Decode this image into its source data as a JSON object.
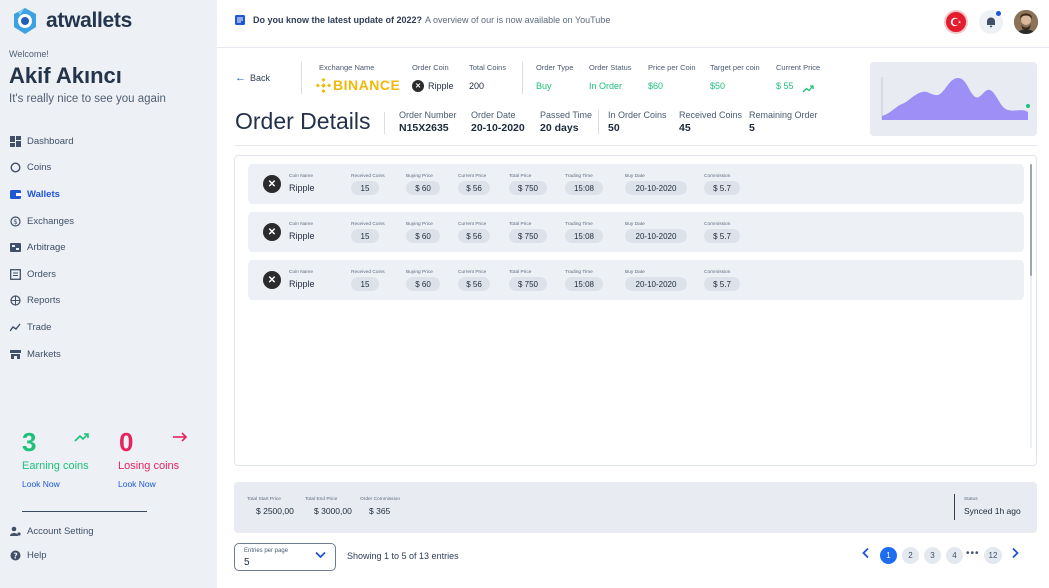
{
  "brand": {
    "name": "atwallets"
  },
  "user": {
    "welcome": "Welcome!",
    "name": "Akif Akıncı",
    "greeting": "It's really nice to see you again"
  },
  "nav": [
    {
      "label": "Dashboard",
      "icon": "dashboard-icon"
    },
    {
      "label": "Coins",
      "icon": "coins-icon"
    },
    {
      "label": "Wallets",
      "icon": "wallet-icon",
      "active": true
    },
    {
      "label": "Exchanges",
      "icon": "exchange-icon"
    },
    {
      "label": "Arbitrage",
      "icon": "arbitrage-icon"
    },
    {
      "label": "Orders",
      "icon": "orders-icon"
    },
    {
      "label": "Reports",
      "icon": "reports-icon"
    },
    {
      "label": "Trade",
      "icon": "trade-icon"
    },
    {
      "label": "Markets",
      "icon": "markets-icon"
    }
  ],
  "stats": {
    "earning": {
      "count": "3",
      "label": "Earning coins",
      "link": "Look Now",
      "color": "#1fc07a"
    },
    "losing": {
      "count": "0",
      "label": "Losing coins",
      "link": "Look Now",
      "color": "#e5245e"
    }
  },
  "sidebar_bottom": {
    "account": "Account Setting",
    "help": "Help"
  },
  "announcement": {
    "bold": "Do you know the latest update of 2022?",
    "text": "A overview of our is now available on YouTube"
  },
  "header": {
    "back": "Back",
    "exchange_name_label": "Exchange Name",
    "exchange_name": "BINANCE",
    "order_coin_label": "Order Coin",
    "order_coin": "Ripple",
    "total_coins_label": "Total Coins",
    "total_coins": "200",
    "order_type_label": "Order Type",
    "order_type": "Buy",
    "order_status_label": "Order Status",
    "order_status": "In Order",
    "price_per_coin_label": "Price per Coin",
    "price_per_coin": "$60",
    "target_per_coin_label": "Target per coin",
    "target_per_coin": "$50",
    "current_price_label": "Current Price",
    "current_price": "$ 55"
  },
  "title": "Order Details",
  "summary": {
    "order_number_label": "Order Number",
    "order_number": "N15X2635",
    "order_date_label": "Order Date",
    "order_date": "20-10-2020",
    "passed_time_label": "Passed Time",
    "passed_time": "20 days",
    "in_order_coins_label": "In Order Coins",
    "in_order_coins": "50",
    "received_coins_label": "Received Coins",
    "received_coins": "45",
    "remaining_order_label": "Remaining Order",
    "remaining_order": "5"
  },
  "columns": {
    "coin_name": "Coin Name",
    "received_coins": "Received Coins",
    "buying_price": "Buying Price",
    "current_price": "Current Price",
    "total_price": "Total Price",
    "trading_time": "Trading Time",
    "buy_date": "Buy Date",
    "commission": "Commission"
  },
  "orders": [
    {
      "coin_name": "Ripple",
      "received_coins": "15",
      "buying_price": "$ 60",
      "current_price": "$ 56",
      "total_price": "$ 750",
      "trading_time": "15:08",
      "buy_date": "20-10-2020",
      "commission": "$ 5.7"
    },
    {
      "coin_name": "Ripple",
      "received_coins": "15",
      "buying_price": "$ 60",
      "current_price": "$ 56",
      "total_price": "$ 750",
      "trading_time": "15:08",
      "buy_date": "20-10-2020",
      "commission": "$ 5.7"
    },
    {
      "coin_name": "Ripple",
      "received_coins": "15",
      "buying_price": "$ 60",
      "current_price": "$ 56",
      "total_price": "$ 750",
      "trading_time": "15:08",
      "buy_date": "20-10-2020",
      "commission": "$ 5.7"
    }
  ],
  "totals": {
    "start_label": "Total Start Price",
    "start": "$ 2500,00",
    "end_label": "Total End Price",
    "end": "$ 3000,00",
    "commission_label": "Order Commission",
    "commission": "$ 365",
    "status_label": "Status",
    "status": "Synced 1h ago"
  },
  "pagination": {
    "entries_label": "Entries per page",
    "entries_value": "5",
    "showing": "Showing 1 to 5 of 13 entries",
    "pages": [
      "1",
      "2",
      "3",
      "4"
    ],
    "last": "12",
    "current": "1"
  },
  "colors": {
    "accent": "#1e56d6",
    "green": "#1fc07a",
    "red": "#e5245e",
    "binance": "#f0b90b",
    "chart": "#9d8ff5"
  }
}
